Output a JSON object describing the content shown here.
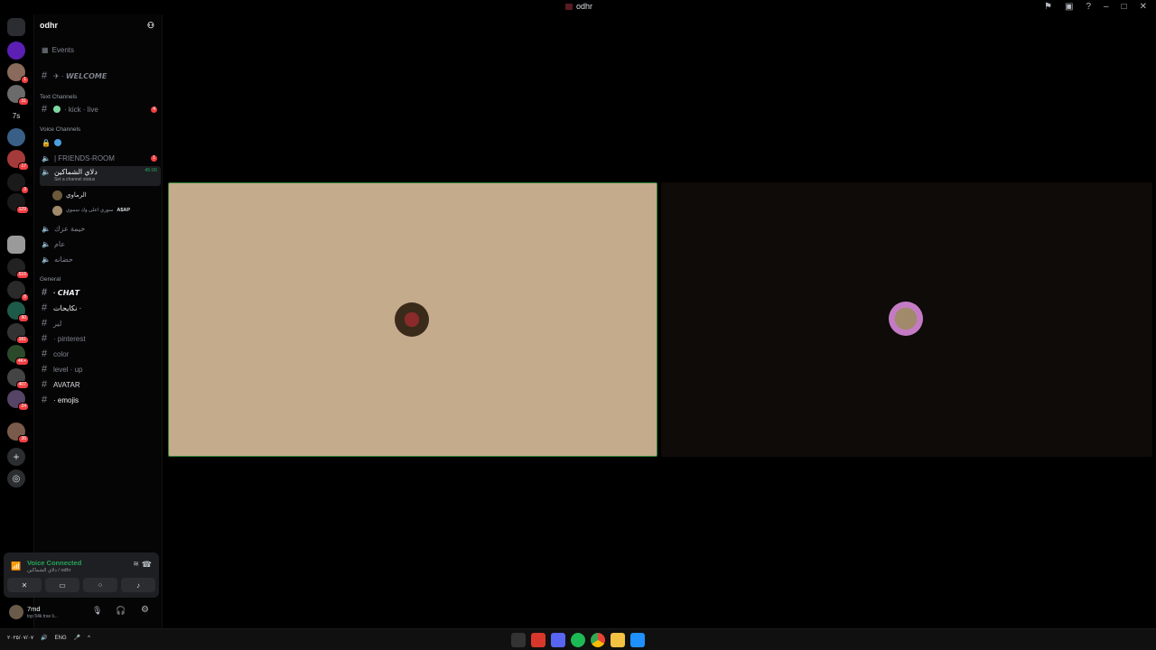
{
  "window": {
    "title": "odhr"
  },
  "server": {
    "name": "odhr",
    "events_label": "Events"
  },
  "rail": {
    "badges": [
      "1",
      "31",
      "7s",
      "17",
      "3",
      "129",
      "516",
      "8",
      "6",
      "90",
      "181",
      "4K+",
      "407",
      "24",
      "36"
    ]
  },
  "channels": {
    "welcome": "✈ · 𝙒𝙀𝙇𝘾𝙊𝙈𝙀",
    "text_category": "Text Channels",
    "kick_live": "· kick · live",
    "kick_badge": "4",
    "voice_category": "Voice Channels",
    "friends_room": "| FRIENDS-ROOM",
    "friends_badge": "1",
    "active_voice": "دلاي الشماكين",
    "active_time": "45:06",
    "set_status": "Set a channel status",
    "user1": "الرماوي",
    "user2": "سوري اعلى وك سموي",
    "user2_tag": "A$AP",
    "voice3": "خيمة عزك",
    "voice4": "عام",
    "voice5": "حضانه",
    "general_category": "General",
    "chat": "· 𝘾𝙃𝘼𝙏",
    "general2": "نكايحات ·",
    "general3": "لير",
    "pinterest": "· pinterest",
    "color": "color",
    "levelup": "level · up",
    "avatar": "AVATAR",
    "emojis": "· emojis"
  },
  "voice_panel": {
    "title": "Voice Connected",
    "sub": "دلاي الشماكين / odhr"
  },
  "user_panel": {
    "name": "7md",
    "status": "top 54k trav li..."
  },
  "taskbar": {
    "date": "٢٠٢٥/٠٧/٠٧",
    "lang": "ENG"
  }
}
